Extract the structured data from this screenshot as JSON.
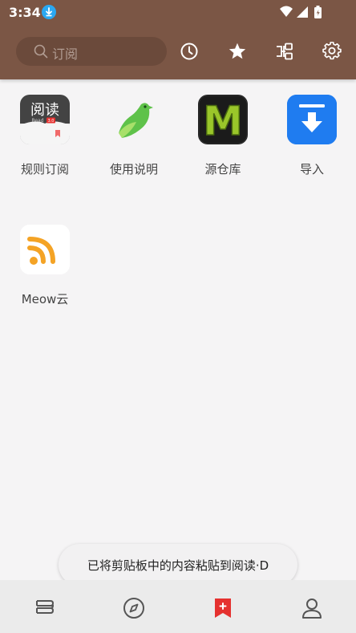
{
  "status_bar": {
    "time": "3:34",
    "icons": [
      "download-icon",
      "wifi-icon",
      "signal-icon",
      "battery-icon"
    ]
  },
  "toolbar": {
    "search_placeholder": "订阅",
    "icons": [
      "history-icon",
      "star-icon",
      "group-icon",
      "settings-icon"
    ]
  },
  "sources": [
    {
      "label": "规则订阅",
      "icon": "yuedu-app-icon"
    },
    {
      "label": "使用说明",
      "icon": "bird-icon"
    },
    {
      "label": "源仓库",
      "icon": "m-logo-icon"
    },
    {
      "label": "导入",
      "icon": "import-icon"
    },
    {
      "label": "Meow云",
      "icon": "rss-icon"
    }
  ],
  "yuedu_icon_text": "阅读",
  "yuedu_icon_sub": "Read",
  "yuedu_icon_version": "3.0",
  "mlogo_letter": "M",
  "toast": {
    "text": "已将剪贴板中的内容粘贴到阅读·D"
  },
  "bottom_nav": {
    "items": [
      "bookshelf-icon",
      "explore-icon",
      "rss-subscribe-icon",
      "profile-icon"
    ],
    "active_index": 2
  },
  "colors": {
    "header": "#7b5645",
    "accent": "#e5312f",
    "import_blue": "#1a73e8",
    "rss_orange": "#f4a325",
    "mlogo_green": "#9ac62a"
  }
}
